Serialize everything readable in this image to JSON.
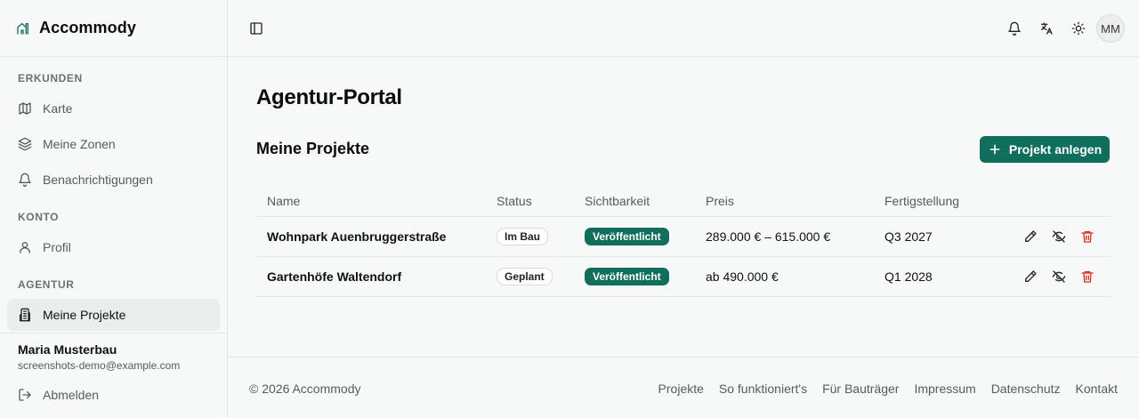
{
  "app": {
    "name": "Accommody"
  },
  "sidebar": {
    "sections": {
      "explore": "ERKUNDEN",
      "account": "KONTO",
      "agency": "AGENTUR"
    },
    "items": [
      {
        "label": "Karte",
        "icon": "map-icon"
      },
      {
        "label": "Meine Zonen",
        "icon": "layers-icon"
      },
      {
        "label": "Benachrichtigungen",
        "icon": "bell-icon"
      },
      {
        "label": "Profil",
        "icon": "user-icon"
      },
      {
        "label": "Meine Projekte",
        "icon": "building-icon",
        "active": true
      }
    ],
    "user": {
      "name": "Maria Musterbau",
      "email": "screenshots-demo@example.com"
    },
    "logout": "Abmelden"
  },
  "topbar": {
    "avatar_initials": "MM"
  },
  "main": {
    "title": "Agentur-Portal",
    "section_title": "Meine Projekte",
    "add_button": "Projekt anlegen",
    "table": {
      "columns": [
        "Name",
        "Status",
        "Sichtbarkeit",
        "Preis",
        "Fertigstellung"
      ],
      "rows": [
        {
          "name": "Wohnpark Auenbruggerstraße",
          "status": "Im Bau",
          "visibility": "Veröffentlicht",
          "price": "289.000 € – 615.000 €",
          "completion": "Q3 2027"
        },
        {
          "name": "Gartenhöfe Waltendorf",
          "status": "Geplant",
          "visibility": "Veröffentlicht",
          "price": "ab 490.000 €",
          "completion": "Q1 2028"
        }
      ]
    }
  },
  "footer": {
    "copyright": "© 2026 Accommody",
    "links": [
      "Projekte",
      "So funktioniert's",
      "Für Bauträger",
      "Impressum",
      "Datenschutz",
      "Kontakt"
    ]
  },
  "colors": {
    "accent": "#0f6e5c",
    "danger": "#d92d20"
  }
}
